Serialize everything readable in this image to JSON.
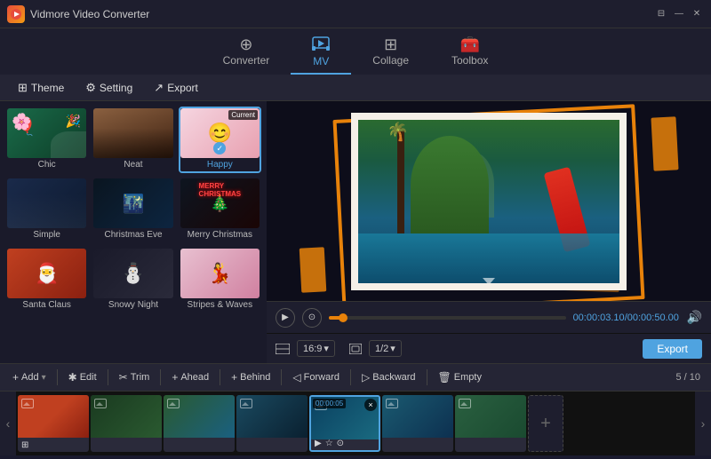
{
  "app": {
    "title": "Vidmore Video Converter",
    "icon": "V"
  },
  "titlebar": {
    "controls": [
      "⊟",
      "—",
      "✕"
    ]
  },
  "nav": {
    "items": [
      {
        "id": "converter",
        "label": "Converter",
        "icon": "⊕",
        "active": false
      },
      {
        "id": "mv",
        "label": "MV",
        "icon": "🎬",
        "active": true
      },
      {
        "id": "collage",
        "label": "Collage",
        "icon": "⊞",
        "active": false
      },
      {
        "id": "toolbox",
        "label": "Toolbox",
        "icon": "🧰",
        "active": false
      }
    ]
  },
  "subtoolbar": {
    "items": [
      {
        "id": "theme",
        "label": "Theme",
        "icon": "⊞"
      },
      {
        "id": "setting",
        "label": "Setting",
        "icon": "⚙"
      },
      {
        "id": "export",
        "label": "Export",
        "icon": "↗"
      }
    ]
  },
  "themes": [
    {
      "id": "chic",
      "label": "Chic",
      "active": false,
      "color": "#1a6b4a"
    },
    {
      "id": "neat",
      "label": "Neat",
      "active": false,
      "color": "#3d2010"
    },
    {
      "id": "happy",
      "label": "Happy",
      "active": true,
      "current": true,
      "color": "#f5c0d0"
    },
    {
      "id": "simple",
      "label": "Simple",
      "active": false,
      "color": "#1a2a4a"
    },
    {
      "id": "christmas-eve",
      "label": "Christmas Eve",
      "active": false,
      "color": "#0a1520"
    },
    {
      "id": "merry-christmas",
      "label": "Merry Christmas",
      "active": false,
      "color": "#0d1520"
    },
    {
      "id": "santa-claus",
      "label": "Santa Claus",
      "active": false,
      "color": "#c04020"
    },
    {
      "id": "snowy-night",
      "label": "Snowy Night",
      "active": false,
      "color": "#1a1a2a"
    },
    {
      "id": "stripes-waves",
      "label": "Stripes & Waves",
      "active": false,
      "color": "#d080a0"
    }
  ],
  "preview": {
    "current_badge": "Current",
    "time_current": "00:00:03.10",
    "time_total": "00:00:50.00",
    "ratio": "16:9",
    "scale": "1/2",
    "export_label": "Export"
  },
  "action_toolbar": {
    "add_label": "+ Add",
    "edit_label": "✏ Edit",
    "trim_label": "✂ Trim",
    "ahead_label": "+ Ahead",
    "behind_label": "+ Behind",
    "forward_label": "◁ Forward",
    "backward_label": "▷ Backward",
    "empty_label": "Empty",
    "page_count": "5 / 10"
  },
  "timeline": {
    "clips": [
      {
        "id": 1,
        "bg": "cb1",
        "has_close": false,
        "active": false
      },
      {
        "id": 2,
        "bg": "cb2",
        "has_close": false,
        "active": false
      },
      {
        "id": 3,
        "bg": "cb3",
        "has_close": false,
        "active": false
      },
      {
        "id": 4,
        "bg": "cb4",
        "has_close": false,
        "active": false
      },
      {
        "id": 5,
        "bg": "cb5",
        "has_close": true,
        "active": true,
        "time": "00:00:05"
      },
      {
        "id": 6,
        "bg": "cb6",
        "has_close": false,
        "active": false
      },
      {
        "id": 7,
        "bg": "cb7",
        "has_close": false,
        "active": false
      }
    ],
    "nav_prev": "‹",
    "nav_next": "›"
  }
}
